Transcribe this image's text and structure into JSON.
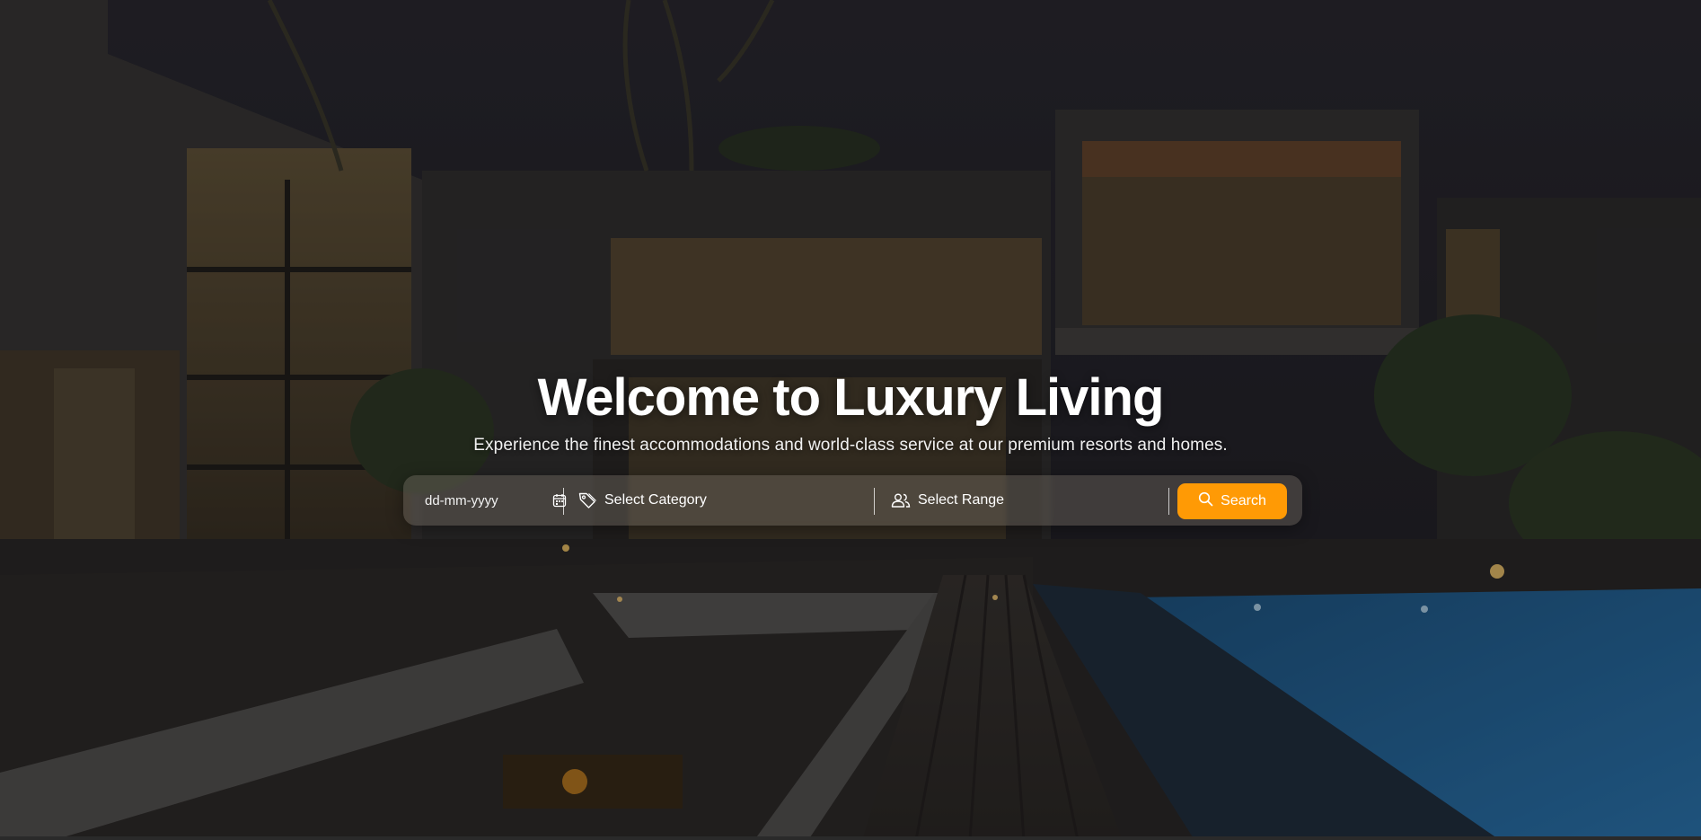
{
  "hero": {
    "title": "Welcome to Luxury Living",
    "subtitle": "Experience the finest accommodations and world-class service at our premium resorts and homes."
  },
  "search": {
    "date_value": "dd-mm-yyyy",
    "date_icon": "calendar-icon",
    "category_label": "Select Category",
    "category_icon": "tag-icon",
    "range_label": "Select Range",
    "range_icon": "users-icon",
    "button_label": "Search",
    "button_icon": "search-icon"
  },
  "colors": {
    "accent": "#ff9a05",
    "text": "#ffffff"
  }
}
